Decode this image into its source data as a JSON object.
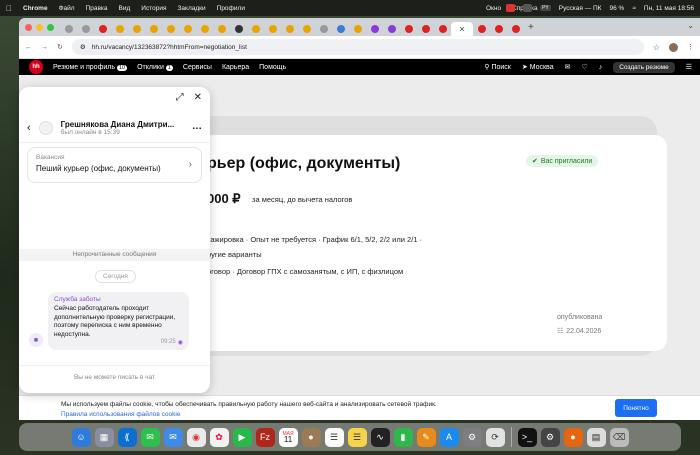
{
  "menubar": {
    "app": "Chrome",
    "items": [
      "Файл",
      "Правка",
      "Вид",
      "История",
      "Закладки",
      "Профили",
      "Окно",
      "Справка"
    ],
    "input_lang": "Русская — ПК",
    "battery": "96 %",
    "datetime": "Пн, 11 мая  18:56"
  },
  "browser": {
    "tab_close": "×",
    "new_tab": "+",
    "url": "hh.ru/vacancy/132363872?hhtmFrom=negotiation_list"
  },
  "hh_nav": {
    "logo": "hh",
    "resume": "Резюме и профиль",
    "resume_count": "10",
    "responses": "Отклики",
    "responses_count": "1",
    "services": "Сервисы",
    "career": "Карьера",
    "help": "Помощь",
    "search": "Поиск",
    "city": "Москва",
    "create_resume": "Создать резюме"
  },
  "vacancy": {
    "title": "рьер (офис, документы)",
    "invited_badge": "Вас пригласили",
    "salary": "000 ₽",
    "salary_note": "за месяц, до вычета налогов",
    "conditions_line1": "тажировка  ·  Опыт не требуется  ·  График 6/1, 5/2, 2/2 или 2/1  ·",
    "conditions_line2": "ругие варианты",
    "conditions_line3": "оговор  ·  Договор ГПХ с самозанятым, с ИП, с физлицом",
    "published_label": "опубликована",
    "published_date": "22.04.2026"
  },
  "chat": {
    "employer_name": "Грешнякова Диана Дмитри...",
    "employer_status": "был онлайн в 15:39",
    "vacancy_label": "Вакансия",
    "vacancy_title": "Пеший курьер (офис, документы)",
    "unread_divider": "Непрочитанные сообщения",
    "date_chip": "Сегодня",
    "message_sender": "Служба заботы",
    "message_text": "Сейчас работодатель проходит дополнительную проверку регистрации, поэтому переписка с ним временно недоступна.",
    "message_time": "09:25",
    "cannot_write": "Вы не можете писать в чат"
  },
  "cookie": {
    "text": "Мы используем файлы cookie, чтобы обеспечивать правильную работу нашего веб-сайта и анализировать сетевой трафик.",
    "link": "Правила использования файлов cookie",
    "ok": "Понятно"
  },
  "dock": {
    "calendar_month": "МАЯ",
    "calendar_day": "11"
  },
  "colors": {
    "hh_red": "#d6001c",
    "invited_green": "#1a7a2e",
    "link_blue": "#2a6ad3",
    "button_blue": "#1b6ff0",
    "sender_purple": "#8a4fd0"
  }
}
